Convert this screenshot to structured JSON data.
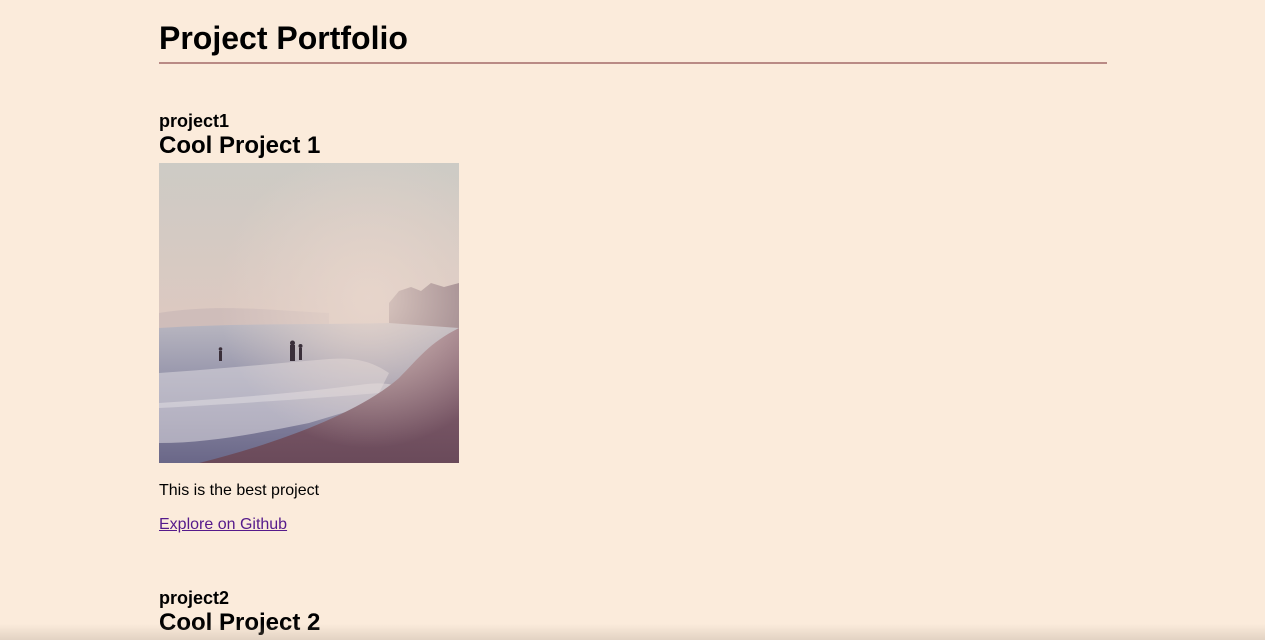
{
  "header": {
    "title": "Project Portfolio"
  },
  "projects": [
    {
      "id": "project1",
      "name": "Cool Project 1",
      "image": "beach-photo",
      "description": "This is the best project",
      "link_label": "Explore on Github"
    },
    {
      "id": "project2",
      "name": "Cool Project 2"
    }
  ],
  "colors": {
    "background": "#fbebdb",
    "divider": "#b98a85",
    "link": "#551a8b"
  }
}
